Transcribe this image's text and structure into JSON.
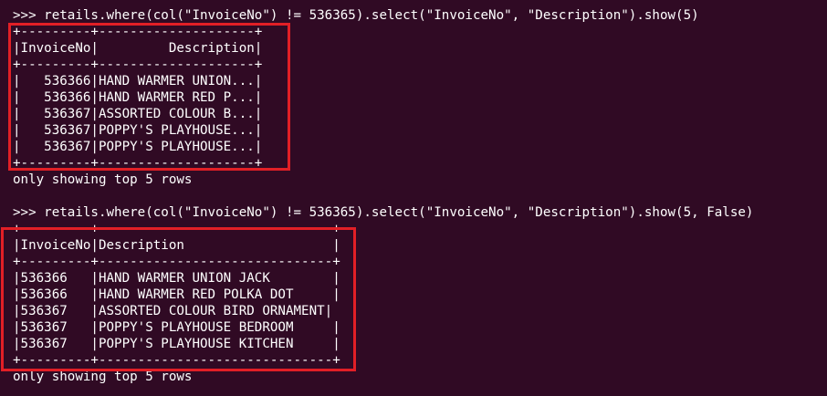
{
  "colors": {
    "background": "#300a24",
    "text": "#ffffff",
    "highlight": "#e21f26"
  },
  "block1": {
    "command": ">>> retails.where(col(\"InvoiceNo\") != 536365).select(\"InvoiceNo\", \"Description\").show(5)",
    "table": [
      "+---------+--------------------+",
      "|InvoiceNo|         Description|",
      "+---------+--------------------+",
      "|   536366|HAND WARMER UNION...|",
      "|   536366|HAND WARMER RED P...|",
      "|   536367|ASSORTED COLOUR B...|",
      "|   536367|POPPY'S PLAYHOUSE...|",
      "|   536367|POPPY'S PLAYHOUSE...|",
      "+---------+--------------------+"
    ],
    "footer": "only showing top 5 rows"
  },
  "block2": {
    "command": ">>> retails.where(col(\"InvoiceNo\") != 536365).select(\"InvoiceNo\", \"Description\").show(5, False)",
    "table": [
      "+---------+------------------------------+",
      "|InvoiceNo|Description                   |",
      "+---------+------------------------------+",
      "|536366   |HAND WARMER UNION JACK        |",
      "|536366   |HAND WARMER RED POLKA DOT     |",
      "|536367   |ASSORTED COLOUR BIRD ORNAMENT|",
      "|536367   |POPPY'S PLAYHOUSE BEDROOM     |",
      "|536367   |POPPY'S PLAYHOUSE KITCHEN     |",
      "+---------+------------------------------+"
    ],
    "footer": "only showing top 5 rows"
  }
}
